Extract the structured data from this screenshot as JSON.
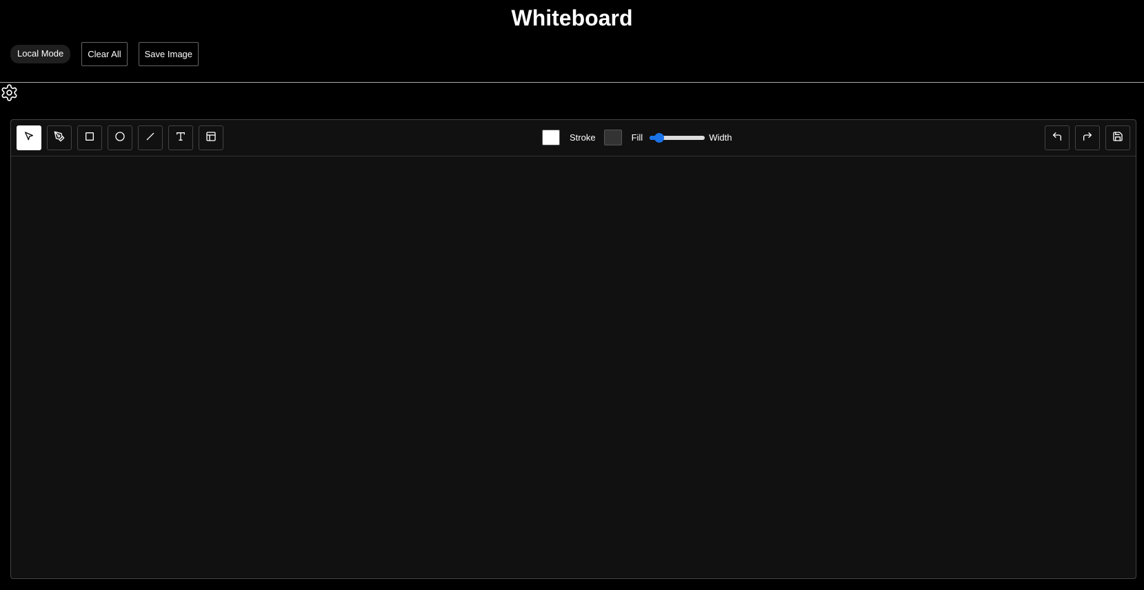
{
  "app": {
    "title": "Whiteboard"
  },
  "header": {
    "mode_label": "Local Mode",
    "clear_label": "Clear All",
    "save_image_label": "Save Image"
  },
  "toolbar": {
    "tools": [
      {
        "name": "select-tool",
        "icon": "pointer-arrow-icon",
        "active": true
      },
      {
        "name": "pen-tool",
        "icon": "pen-nib-icon",
        "active": false
      },
      {
        "name": "rectangle-tool",
        "icon": "square-icon",
        "active": false
      },
      {
        "name": "circle-tool",
        "icon": "circle-icon",
        "active": false
      },
      {
        "name": "line-tool",
        "icon": "line-icon",
        "active": false
      },
      {
        "name": "text-tool",
        "icon": "text-t-icon",
        "active": false
      },
      {
        "name": "template-tool",
        "icon": "layout-icon",
        "active": false
      }
    ],
    "stroke_label": "Stroke",
    "stroke_color": "#ffffff",
    "fill_label": "Fill",
    "fill_color": "#333333",
    "width_label": "Width",
    "width_value_fraction": 0.1,
    "actions": [
      {
        "name": "undo-button",
        "icon": "undo-icon"
      },
      {
        "name": "redo-button",
        "icon": "redo-icon"
      },
      {
        "name": "save-button",
        "icon": "floppy-disk-icon"
      }
    ]
  },
  "colors": {
    "accent": "#1a73e8",
    "background": "#000000",
    "board": "#111111"
  }
}
